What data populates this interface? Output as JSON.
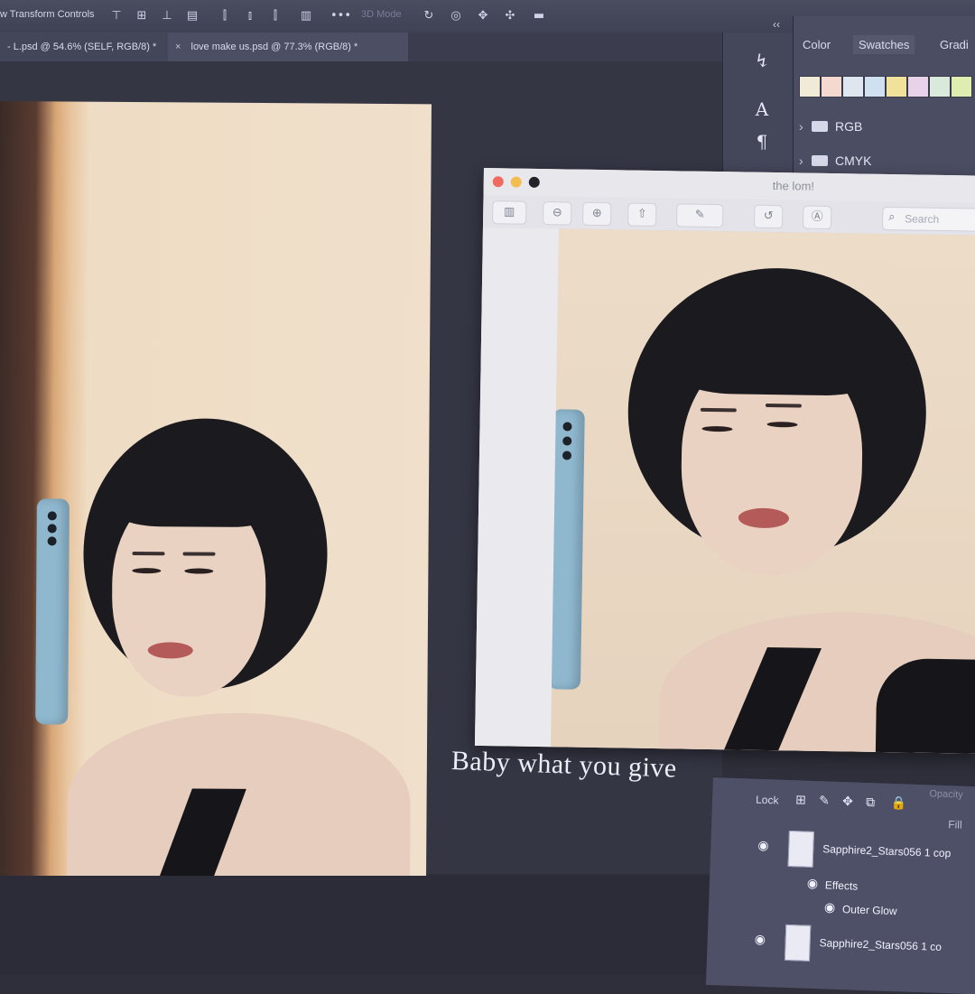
{
  "optionbar": {
    "label": "w Transform Controls",
    "mode3d": "3D Mode"
  },
  "tabs": [
    {
      "label": "- L.psd @ 54.6% (SELF, RGB/8) *"
    },
    {
      "close": "×",
      "label": "love make us.psd @ 77.3% (RGB/8) *"
    }
  ],
  "panel": {
    "collapse": "‹‹",
    "tabs": [
      "Color",
      "Swatches",
      "Gradi"
    ],
    "swatch_colors": [
      "#f0ead6",
      "#f3d9d0",
      "#dfe6f0",
      "#cfe0f0",
      "#f0e29a",
      "#e8d2ea",
      "#d9eadc",
      "#dfeeb0",
      "#d0e6ea",
      "#f0e8cf"
    ],
    "folders": [
      "RGB",
      "CMYK"
    ]
  },
  "preview": {
    "window_name": "the lom!",
    "search_placeholder": "Search"
  },
  "caption": "Baby what you give",
  "layers": {
    "lock_label": "Lock",
    "fill_label": "Fill",
    "opacity_label": "Opacity",
    "rows": [
      {
        "name": "Sapphire2_Stars056 1 cop"
      },
      {
        "name": "Effects"
      },
      {
        "name": "Outer Glow"
      },
      {
        "name": "Sapphire2_Stars056 1 co"
      }
    ]
  }
}
